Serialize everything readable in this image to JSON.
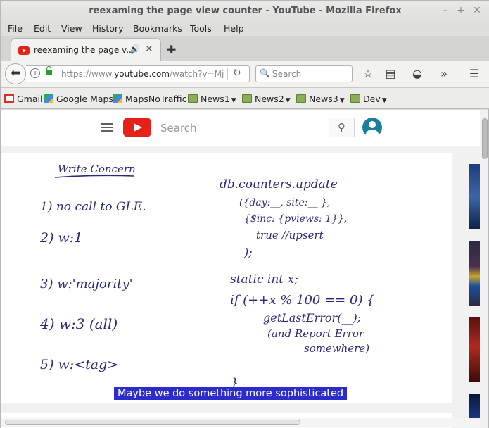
{
  "window": {
    "title": "reexaming the page view counter - YouTube - Mozilla Firefox"
  },
  "menubar": {
    "items": [
      "File",
      "Edit",
      "View",
      "History",
      "Bookmarks",
      "Tools",
      "Help"
    ],
    "mnemonics": [
      "F",
      "E",
      "V",
      "H",
      "B",
      "T",
      "H"
    ]
  },
  "tab": {
    "title": "reexaming the page v...",
    "audio_icon": "speaker-icon",
    "close_label": "✕",
    "new_tab_label": "✚"
  },
  "navbar": {
    "url_prefix": "https://www.",
    "url_host": "youtube.com",
    "url_path": "/watch?v=Mj",
    "search_placeholder": "Search"
  },
  "bookmarks": [
    {
      "label": "Gmail",
      "icon": "gmail-icon",
      "folder": false
    },
    {
      "label": "Google Maps",
      "icon": "maps-icon",
      "folder": false
    },
    {
      "label": "MapsNoTraffic",
      "icon": "maps-icon",
      "folder": false
    },
    {
      "label": "News1",
      "icon": "folder-icon",
      "folder": true
    },
    {
      "label": "News2",
      "icon": "folder-icon",
      "folder": true
    },
    {
      "label": "News3",
      "icon": "folder-icon",
      "folder": true
    },
    {
      "label": "Dev",
      "icon": "folder-icon",
      "folder": true
    }
  ],
  "youtube": {
    "search_placeholder": "Search",
    "caption": "Maybe we do something more sophisticated"
  },
  "whiteboard": {
    "heading": "Write Concern",
    "list": [
      "1) no call to GLE.",
      "2) w:1",
      "3) w:'majority'",
      "4) w:3  (all)",
      "5) w:<tag>"
    ],
    "code": [
      "db.counters.update",
      "({day:__, site:__ },",
      "{$inc: {pviews: 1}},",
      "true //upsert",
      ");",
      "static int x;",
      "if (++x % 100 == 0) {",
      "getLastError(__);",
      "(and Report Error",
      "somewhere)",
      "}"
    ]
  },
  "colors": {
    "ink": "#2a2a7a",
    "caption_bg": "#2c2ccc",
    "youtube_red": "#e62117"
  }
}
